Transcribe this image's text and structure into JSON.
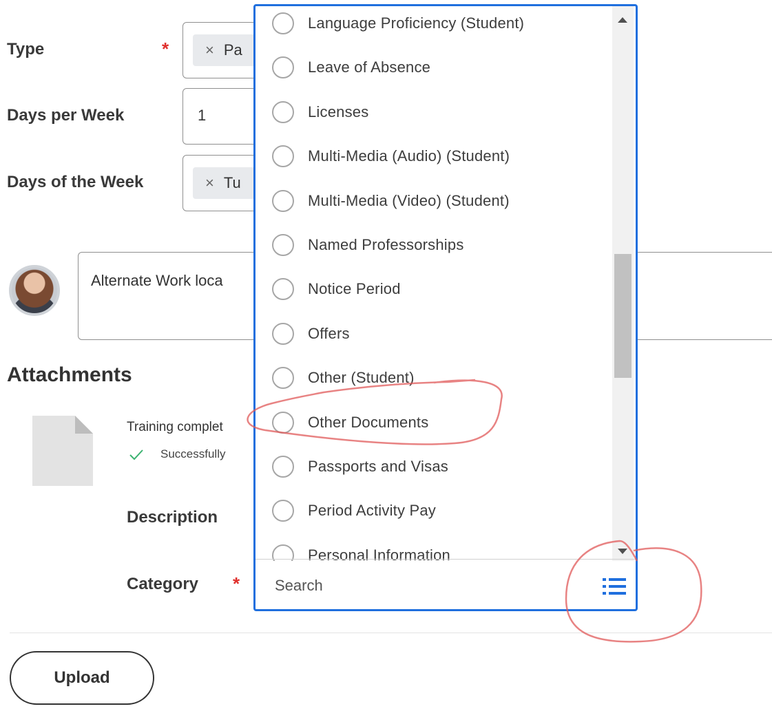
{
  "form": {
    "type_label": "Type",
    "type_pill": "Pa",
    "days_per_week_label": "Days per Week",
    "days_per_week_value": "1",
    "days_of_week_label": "Days of the Week",
    "days_of_week_pill": "Tu",
    "required_mark": "*",
    "remove_glyph": "×"
  },
  "comment": {
    "text": "Alternate Work loca"
  },
  "attachments": {
    "heading": "Attachments",
    "file_name": "Training complet",
    "status_text": "Successfully",
    "description_label": "Description",
    "category_label": "Category"
  },
  "upload_label": "Upload",
  "dropdown": {
    "options": [
      "Language Proficiency (Student)",
      "Leave of Absence",
      "Licenses",
      "Multi-Media (Audio) (Student)",
      "Multi-Media (Video) (Student)",
      "Named Professorships",
      "Notice Period",
      "Offers",
      "Other (Student)",
      "Other Documents",
      "Passports and Visas",
      "Period Activity Pay",
      "Personal Information"
    ],
    "search_placeholder": "Search"
  },
  "colors": {
    "accent": "#1f6fde",
    "required": "#e0302d",
    "success": "#3cb371",
    "annotation": "#e05a5a"
  }
}
